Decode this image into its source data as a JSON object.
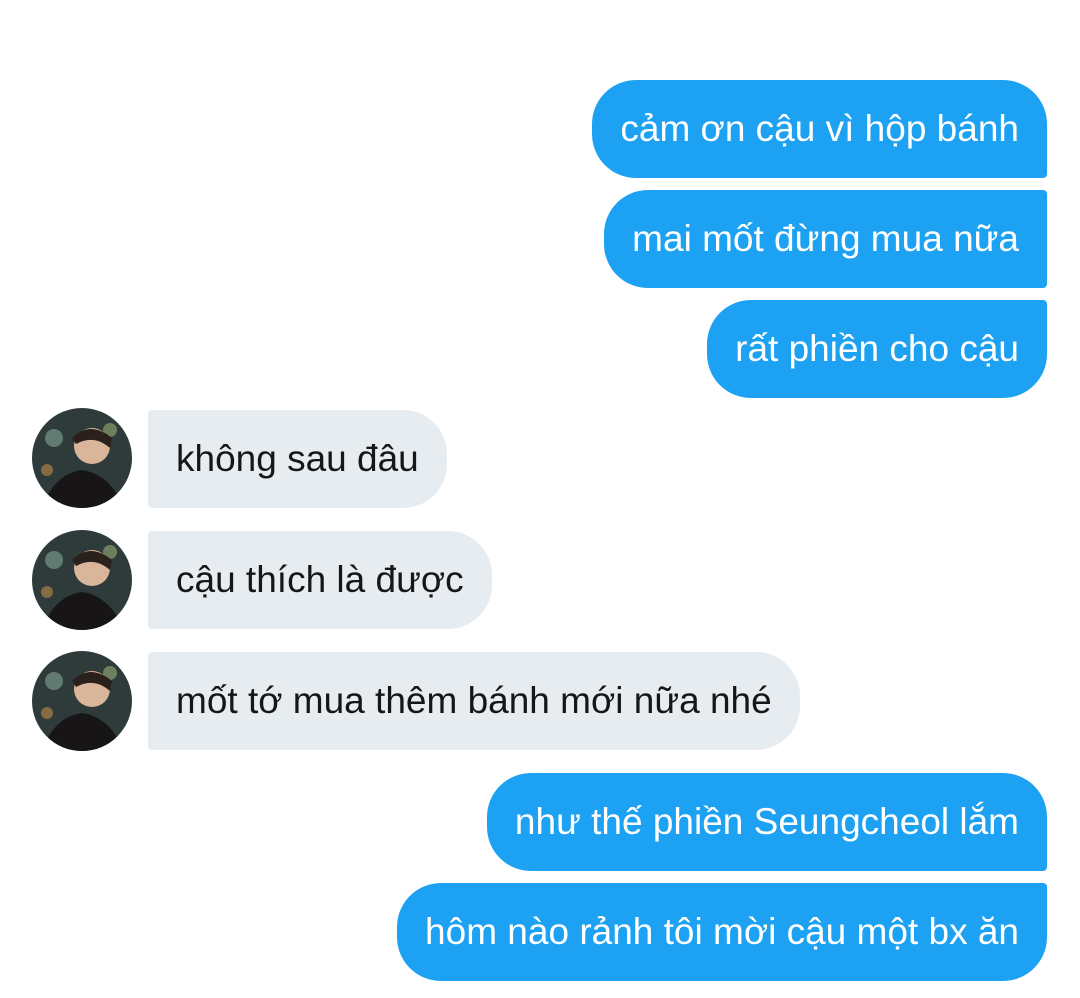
{
  "conversation": {
    "messages": [
      {
        "from": "me",
        "text": "cảm ơn cậu vì hộp bánh"
      },
      {
        "from": "me",
        "text": "mai mốt đừng mua nữa"
      },
      {
        "from": "me",
        "text": "rất phiền cho cậu"
      },
      {
        "from": "them",
        "text": "không sau đâu"
      },
      {
        "from": "them",
        "text": "cậu thích là được"
      },
      {
        "from": "them",
        "text": "mốt tớ mua thêm bánh mới nữa nhé"
      },
      {
        "from": "me",
        "text": "như thế phiền Seungcheol lắm"
      },
      {
        "from": "me",
        "text": "hôm nào rảnh tôi mời cậu một bx ăn"
      }
    ]
  },
  "colors": {
    "sent_bubble": "#1da1f2",
    "received_bubble": "#e6ecf0",
    "sent_text": "#ffffff",
    "received_text": "#14171a"
  },
  "icons": {
    "contact_avatar": "profile-photo-avatar-icon"
  }
}
